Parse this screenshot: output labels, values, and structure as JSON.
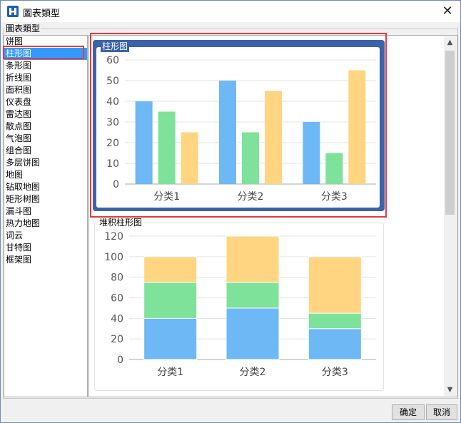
{
  "window": {
    "title": "圖表類型",
    "close_symbol": "✕"
  },
  "group": {
    "legend": "圖表類型"
  },
  "chart_types": [
    "饼图",
    "柱形图",
    "条形图",
    "折线图",
    "面积图",
    "仪表盘",
    "雷达图",
    "散点图",
    "气泡图",
    "组合图",
    "多层饼图",
    "地图",
    "钻取地图",
    "矩形树图",
    "漏斗图",
    "热力地图",
    "词云",
    "甘特图",
    "框架图"
  ],
  "selected_type": "柱形图",
  "buttons": {
    "ok": "确定",
    "cancel": "取消"
  },
  "scrollbar": {
    "up": "▲",
    "down": "▼"
  },
  "colors": {
    "blue": "#6db8f5",
    "green": "#7ee29a",
    "orange": "#ffd582",
    "selection": "#3399ff",
    "highlight": "#e8383d",
    "card_border": "#3a63a8"
  },
  "previews": [
    {
      "label": "柱形图",
      "chart_data": {
        "type": "bar",
        "categories": [
          "分类1",
          "分类2",
          "分类3"
        ],
        "series": [
          {
            "values": [
              40,
              50,
              30
            ]
          },
          {
            "values": [
              35,
              25,
              15
            ]
          },
          {
            "values": [
              25,
              45,
              55
            ]
          }
        ],
        "ylim": [
          0,
          60
        ],
        "yticks": [
          0,
          10,
          20,
          30,
          40,
          50,
          60
        ],
        "grid": true
      }
    },
    {
      "label": "堆积柱形图",
      "chart_data": {
        "type": "bar",
        "stacked": true,
        "categories": [
          "分类1",
          "分类2",
          "分类3"
        ],
        "series": [
          {
            "values": [
              40,
              50,
              30
            ]
          },
          {
            "values": [
              35,
              25,
              15
            ]
          },
          {
            "values": [
              25,
              45,
              55
            ]
          }
        ],
        "ylim": [
          0,
          120
        ],
        "yticks": [
          0,
          20,
          40,
          60,
          80,
          100,
          120
        ],
        "grid": true
      }
    }
  ]
}
